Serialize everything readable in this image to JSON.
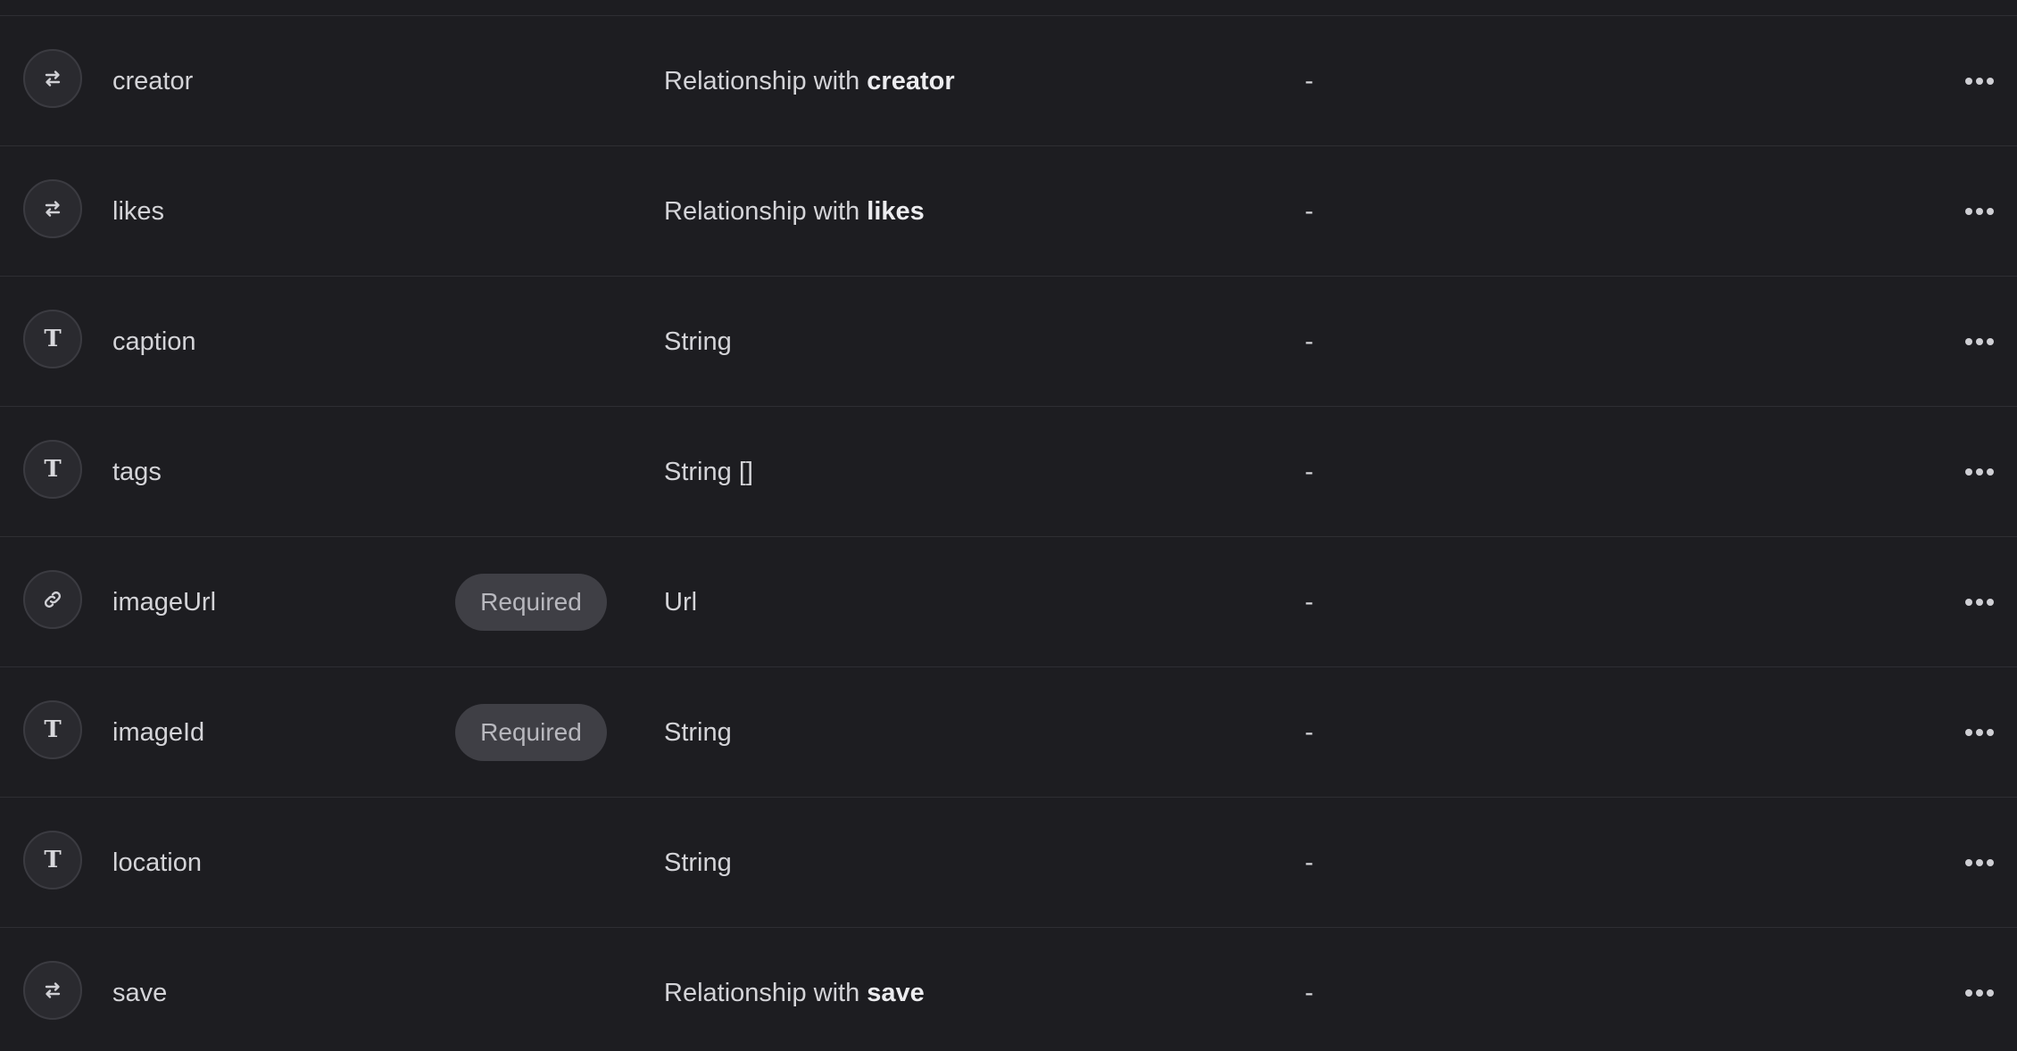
{
  "attributes": [
    {
      "icon": "relationship-icon",
      "name": "creator",
      "required": false,
      "type_prefix": "Relationship with ",
      "type_bold": "creator",
      "default": "-"
    },
    {
      "icon": "relationship-icon",
      "name": "likes",
      "required": false,
      "type_prefix": "Relationship with ",
      "type_bold": "likes",
      "default": "-"
    },
    {
      "icon": "text-icon",
      "name": "caption",
      "required": false,
      "type_prefix": "String",
      "type_bold": "",
      "default": "-"
    },
    {
      "icon": "text-icon",
      "name": "tags",
      "required": false,
      "type_prefix": "String []",
      "type_bold": "",
      "default": "-"
    },
    {
      "icon": "link-icon",
      "name": "imageUrl",
      "required": true,
      "badge": "Required",
      "type_prefix": "Url",
      "type_bold": "",
      "default": "-"
    },
    {
      "icon": "text-icon",
      "name": "imageId",
      "required": true,
      "badge": "Required",
      "type_prefix": "String",
      "type_bold": "",
      "default": "-"
    },
    {
      "icon": "text-icon",
      "name": "location",
      "required": false,
      "type_prefix": "String",
      "type_bold": "",
      "default": "-"
    },
    {
      "icon": "relationship-icon",
      "name": "save",
      "required": false,
      "type_prefix": "Relationship with ",
      "type_bold": "save",
      "default": "-"
    }
  ],
  "icon_glyphs": {
    "text-icon": "T"
  },
  "colors": {
    "background": "#1d1d21",
    "divider": "#2e2e33",
    "badge_bg": "#3f3f45"
  }
}
